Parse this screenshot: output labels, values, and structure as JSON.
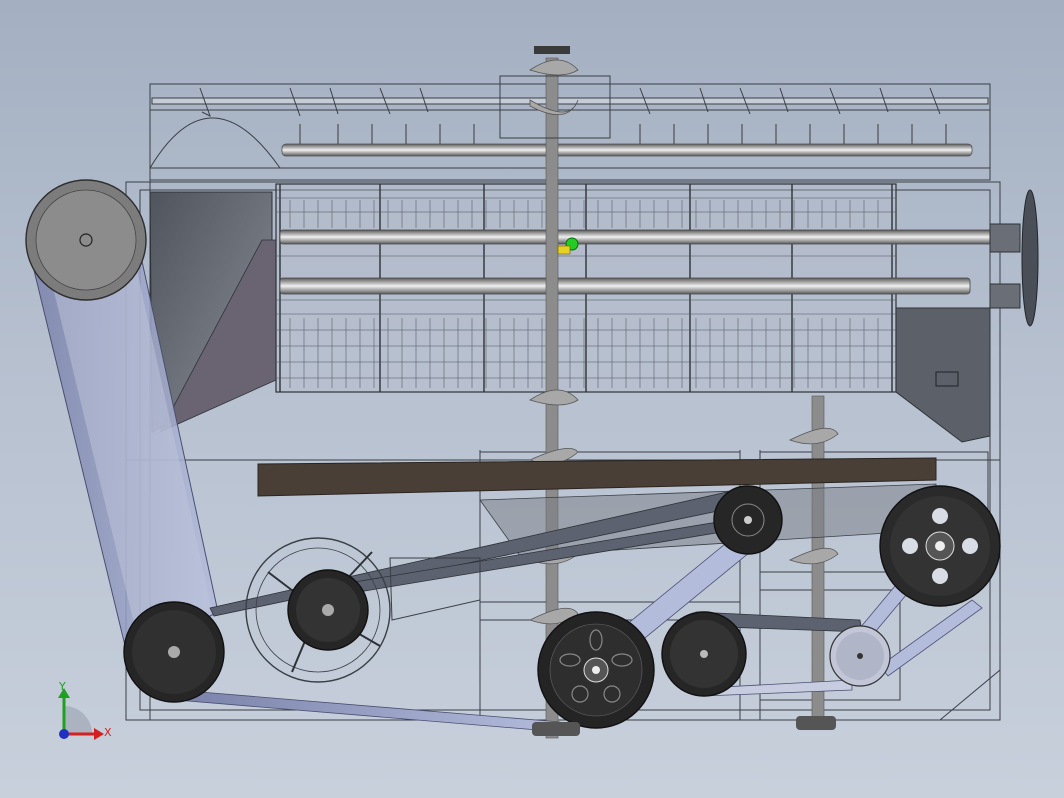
{
  "viewport": {
    "background_top": "#a4b0c2",
    "background_bottom": "#c8d0dc"
  },
  "triad": {
    "x_label": "X",
    "y_label": "Y",
    "x_color": "#d42020",
    "y_color": "#20a020",
    "z_color": "#2030c0"
  },
  "model": {
    "frame_line_color": "#3a3f46",
    "hopper_fill": "#5a5e66",
    "conveyor_fill": "#4a3f36",
    "pulley_fill": "#262626",
    "belt_fill": "#8890b8",
    "auger_fill": "#9a9a9a",
    "marker_color": "#22cc22"
  }
}
